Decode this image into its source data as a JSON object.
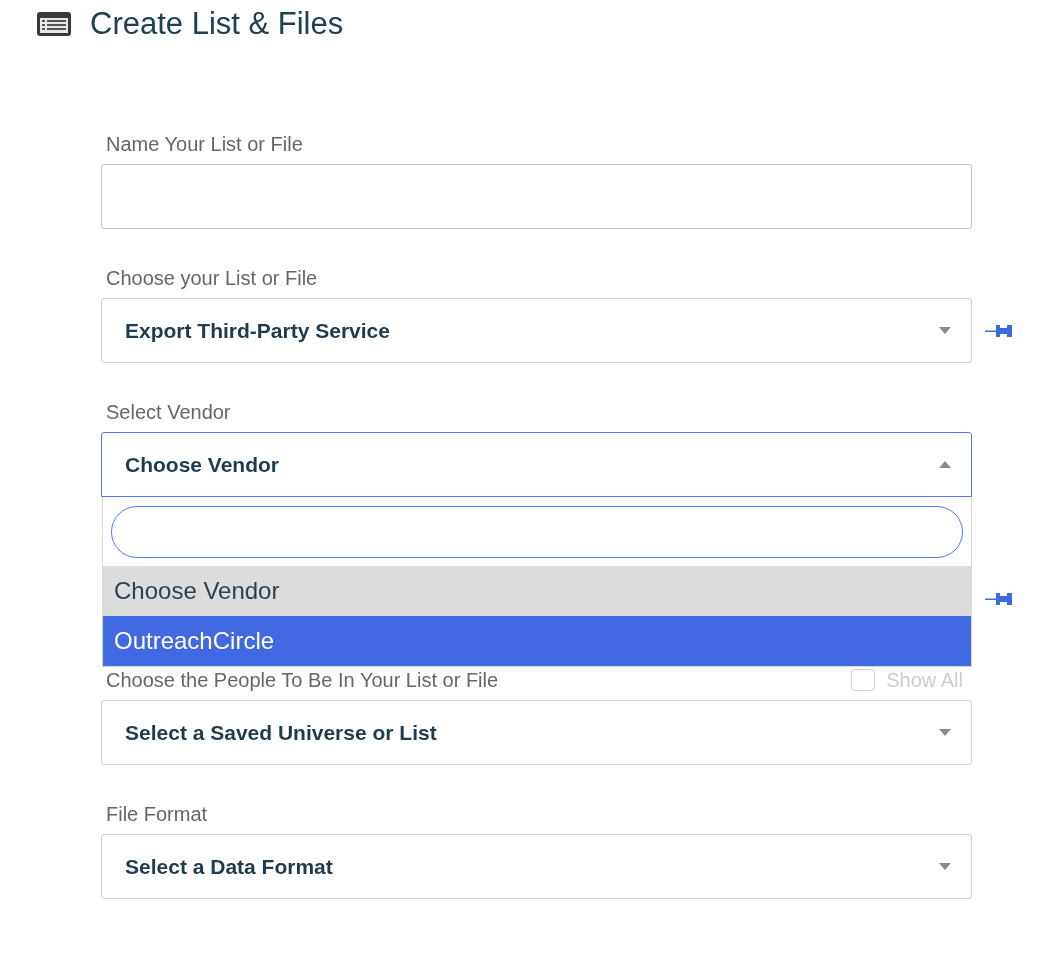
{
  "header": {
    "title": "Create List & Files"
  },
  "fields": [
    {
      "kind": "text",
      "label": "Name Your List or File",
      "pin": false
    },
    {
      "kind": "select",
      "label": "Choose your List or File",
      "value": "Export Third-Party Service",
      "pin": true,
      "open": false
    },
    {
      "kind": "select",
      "label": "Select Vendor",
      "value": "Choose Vendor",
      "pin": false,
      "open": true,
      "dropdown": {
        "options": [
          {
            "label": "Choose Vendor",
            "selected": true,
            "highlighted": false
          },
          {
            "label": "OutreachCircle",
            "selected": false,
            "highlighted": true
          }
        ]
      }
    },
    {
      "kind": "covered",
      "pin": true
    },
    {
      "kind": "select",
      "label": "Choose the People To Be In Your List or File",
      "value": "Select a Saved Universe or List",
      "pin": false,
      "open": false,
      "option": {
        "label": "Show All",
        "checked": false,
        "disabled": true
      }
    },
    {
      "kind": "select",
      "label": "File Format",
      "value": "Select a Data Format",
      "pin": false,
      "open": false
    }
  ]
}
